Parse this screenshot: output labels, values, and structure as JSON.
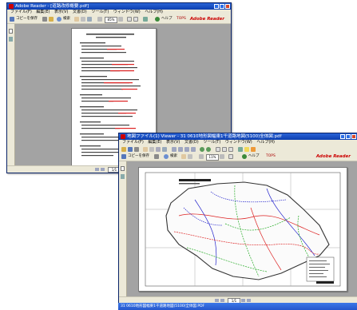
{
  "window1": {
    "title": "Adobe Reader - [道路改修概要.pdf]",
    "menu": [
      "ファイル(F)",
      "編集(E)",
      "表示(V)",
      "文書(D)",
      "ツール(T)",
      "ウィンドウ(W)",
      "ヘルプ(H)"
    ],
    "toolbar": {
      "copy_label": "コピーを保存",
      "search_label": "検索",
      "zoom_value": "85%",
      "help_label": "ヘルプ",
      "tutorial_label": "TOPS"
    },
    "brand": "Adobe Reader",
    "page_info": "1/1"
  },
  "window2": {
    "title": "地図ファイル(1) Viewer - 31 0610地形図幅東1千道路地図(5100)全体図.pdf",
    "menu": [
      "ファイル(F)",
      "編集(E)",
      "表示(V)",
      "文書(D)",
      "ツール(T)",
      "ウィンドウ(W)",
      "ヘルプ(H)"
    ],
    "toolbar": {
      "copy_label": "コピーを保存",
      "search_label": "検索",
      "zoom_value": "11%",
      "help_label": "ヘルプ",
      "tutorial_label": "TOPS"
    },
    "brand": "Adobe Reader",
    "page_info": "1/1"
  },
  "taskbar_text": "31 0610地形図幅東1千道路地図(5100)全体図.PDF",
  "colors": {
    "titlebar": "#1c50c8",
    "brand": "#cc0000",
    "desktop": "#ffffff",
    "doc_bg": "#a3a3a3",
    "map_outline": "#3a3a3a",
    "road_red": "#d22",
    "road_blue": "#22c",
    "road_green": "#2a2"
  }
}
